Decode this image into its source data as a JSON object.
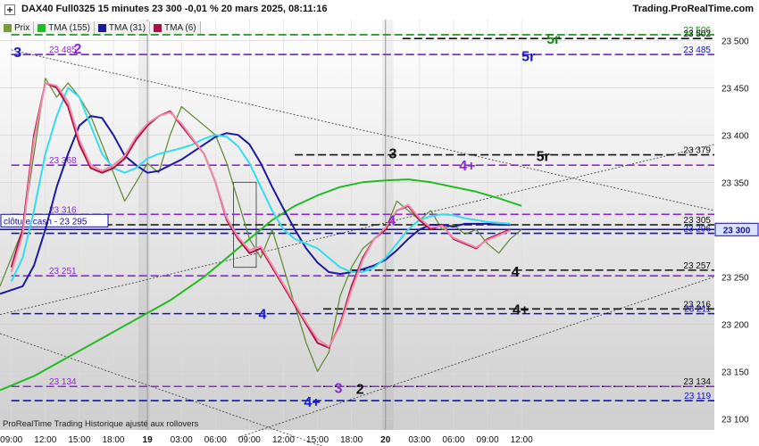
{
  "header": {
    "title": "DAX40 Full0325 15 minutes 23 300 -0,01 % 20 mars 2025, 08:11:16",
    "site": "Trading.ProRealTime.com"
  },
  "legend": [
    {
      "label": "Prix",
      "color": "#7a9a3a"
    },
    {
      "label": "TMA (155)",
      "color": "#22bb22"
    },
    {
      "label": "TMA (31)",
      "color": "#1a1aa0"
    },
    {
      "label": "TMA (6)",
      "color": "#aa1040"
    }
  ],
  "footer_note": "ProRealTime Trading  Historique ajusté aux rollovers",
  "close_label": "clôture cash -  23 295",
  "chart_data": {
    "type": "line",
    "title": "DAX40 Full0325 15 minutes",
    "ylim": [
      23088,
      23522
    ],
    "y_ticks": [
      23100,
      23150,
      23200,
      23250,
      23300,
      23350,
      23400,
      23450,
      23500
    ],
    "y_tick_labels": [
      "23 100",
      "23 150",
      "23 200",
      "23 250",
      "23 300",
      "23 350",
      "23 400",
      "23 450",
      "23 500"
    ],
    "current_price": 23300,
    "current_price_label": "23 300",
    "x_tick_labels": [
      "09:00",
      "12:00",
      "15:00",
      "18:00",
      "19",
      "03:00",
      "06:00",
      "09:00",
      "12:00",
      "15:00",
      "18:00",
      "20",
      "03:00",
      "06:00",
      "09:00",
      "12:00"
    ],
    "x_tick_bold": [
      false,
      false,
      false,
      false,
      true,
      false,
      false,
      false,
      false,
      false,
      false,
      true,
      false,
      false,
      false,
      false
    ],
    "x_range_hours": [
      -1,
      62
    ],
    "x_tick_hours": [
      0,
      3,
      6,
      9,
      12,
      15,
      18,
      21,
      24,
      27,
      30,
      33,
      36,
      39,
      42,
      45
    ],
    "levels": [
      {
        "value": 23506,
        "label": "23 506",
        "color": "#1a8a1a",
        "style": "dash",
        "side": "right",
        "x_start": 0
      },
      {
        "value": 23502,
        "label": "23 502",
        "color": "#111111",
        "style": "dash",
        "side": "right",
        "x_start": 34.5
      },
      {
        "value": 23485,
        "label": "23 485",
        "color": "#1010c8",
        "style": "dash",
        "side": "right",
        "x_start": 0
      },
      {
        "value": 23485,
        "label": "23 485",
        "color": "#8a2ad0",
        "style": "dash",
        "side": "left",
        "x_start": 0
      },
      {
        "value": 23379,
        "label": "23 379",
        "color": "#111111",
        "style": "dash",
        "side": "right",
        "x_start": 25
      },
      {
        "value": 23368,
        "label": "23 368",
        "color": "#8a2ad0",
        "style": "dash",
        "side": "left",
        "x_start": 0
      },
      {
        "value": 23316,
        "label": "23 316",
        "color": "#8a2ad0",
        "style": "dash",
        "side": "left",
        "x_start": 0
      },
      {
        "value": 23305,
        "label": "23 305",
        "color": "#111111",
        "style": "dash",
        "side": "right",
        "x_start": 0
      },
      {
        "value": 23296,
        "label": "23 296",
        "color": "#1010c8",
        "style": "dash",
        "side": "right",
        "x_start": 0
      },
      {
        "value": 23257,
        "label": "23 257",
        "color": "#111111",
        "style": "dash",
        "side": "right",
        "x_start": 30
      },
      {
        "value": 23251,
        "label": "23 251",
        "color": "#8a2ad0",
        "style": "dash",
        "side": "left",
        "x_start": 0
      },
      {
        "value": 23216,
        "label": "23 216",
        "color": "#111111",
        "style": "dash",
        "side": "right",
        "x_start": 27.5
      },
      {
        "value": 23211,
        "label": "23 211",
        "color": "#1010c8",
        "style": "dash",
        "side": "right",
        "x_start": 0
      },
      {
        "value": 23134,
        "label": "23 134",
        "color": "#111111",
        "style": "dash",
        "side": "right",
        "x_start": 27.5
      },
      {
        "value": 23134,
        "label": "23 134",
        "color": "#8a2ad0",
        "style": "dash",
        "side": "left",
        "x_start": 0
      },
      {
        "value": 23119,
        "label": "23 119",
        "color": "#1010c8",
        "style": "dash",
        "side": "right",
        "x_start": 0
      }
    ],
    "wave_labels": [
      {
        "text": "3",
        "x": 0.2,
        "y": 23488,
        "color": "#1a1ad0"
      },
      {
        "text": "2",
        "x": 5.5,
        "y": 23492,
        "color": "#8a2ad0"
      },
      {
        "text": "5r",
        "x": 45,
        "y": 23484,
        "color": "#1a1ad0"
      },
      {
        "text": "5r",
        "x": 47.2,
        "y": 23502,
        "color": "#1a8a1a"
      },
      {
        "text": "3",
        "x": 33.3,
        "y": 23381,
        "color": "#111111"
      },
      {
        "text": "4+",
        "x": 39.5,
        "y": 23368,
        "color": "#8a2ad0"
      },
      {
        "text": "5r",
        "x": 46.3,
        "y": 23378,
        "color": "#111111"
      },
      {
        "text": "4",
        "x": 33.2,
        "y": 23310,
        "color": "#8a2ad0"
      },
      {
        "text": "4",
        "x": 44.1,
        "y": 23256,
        "color": "#111111"
      },
      {
        "text": "4",
        "x": 21.8,
        "y": 23211,
        "color": "#1a1ad0"
      },
      {
        "text": "4+",
        "x": 44.2,
        "y": 23216,
        "color": "#111111"
      },
      {
        "text": "3",
        "x": 28.5,
        "y": 23133,
        "color": "#8a2ad0"
      },
      {
        "text": "2",
        "x": 30.4,
        "y": 23132,
        "color": "#111111"
      },
      {
        "text": "4+",
        "x": 25.8,
        "y": 23118,
        "color": "#1a1ad0"
      }
    ],
    "series": [
      {
        "name": "Prix",
        "color": "#5a8a2a",
        "x": [
          -1,
          0,
          1,
          2,
          3,
          4,
          5,
          6,
          7,
          8,
          9,
          10,
          11,
          12,
          13,
          14,
          15,
          16,
          17,
          18,
          19,
          20,
          21,
          22,
          23,
          24,
          25,
          26,
          27,
          28,
          29,
          30,
          31,
          32,
          33,
          34,
          35,
          36,
          37,
          38,
          39,
          40,
          41,
          42,
          43,
          44,
          45
        ],
        "y": [
          23240,
          23270,
          23300,
          23380,
          23460,
          23440,
          23455,
          23440,
          23420,
          23390,
          23360,
          23330,
          23350,
          23370,
          23360,
          23400,
          23430,
          23420,
          23410,
          23400,
          23370,
          23330,
          23290,
          23270,
          23300,
          23260,
          23220,
          23180,
          23150,
          23170,
          23230,
          23260,
          23280,
          23290,
          23300,
          23330,
          23320,
          23310,
          23320,
          23300,
          23305,
          23295,
          23300,
          23285,
          23275,
          23290,
          23300
        ]
      },
      {
        "name": "TMA (155)",
        "color": "#22bb22",
        "x": [
          -1,
          2,
          5,
          8,
          11,
          14,
          17,
          19,
          21,
          23,
          25,
          27,
          29,
          31,
          33,
          35,
          37,
          39,
          41,
          43,
          45
        ],
        "y": [
          23130,
          23145,
          23165,
          23185,
          23205,
          23225,
          23250,
          23270,
          23290,
          23310,
          23325,
          23336,
          23345,
          23350,
          23352,
          23353,
          23350,
          23345,
          23340,
          23333,
          23325
        ]
      },
      {
        "name": "TMA (31)",
        "color": "#1a1aa0",
        "x": [
          -1,
          1,
          2,
          3,
          4,
          5,
          6,
          7,
          8,
          9,
          10,
          11,
          12,
          13,
          14,
          15,
          16,
          17,
          18,
          19,
          20,
          21,
          22,
          23,
          24,
          25,
          26,
          27,
          28,
          29,
          30,
          31,
          32,
          33,
          34,
          35,
          36,
          37,
          38,
          39,
          40,
          41,
          42,
          43,
          44
        ],
        "y": [
          23232,
          23240,
          23262,
          23300,
          23345,
          23380,
          23410,
          23420,
          23418,
          23400,
          23378,
          23368,
          23360,
          23362,
          23368,
          23374,
          23382,
          23390,
          23398,
          23402,
          23400,
          23390,
          23370,
          23345,
          23322,
          23300,
          23280,
          23265,
          23255,
          23253,
          23255,
          23258,
          23262,
          23268,
          23278,
          23290,
          23300,
          23305,
          23305,
          23303,
          23306,
          23306,
          23306,
          23305,
          23305
        ]
      },
      {
        "name": "TMA (31) cyan",
        "color": "#33ddee",
        "x": [
          0,
          1,
          2,
          3,
          4,
          5,
          6,
          7,
          8,
          9,
          10,
          11,
          12,
          13,
          14,
          15,
          16,
          17,
          18,
          19,
          20,
          21,
          22,
          23,
          24,
          25,
          26,
          27,
          28,
          29,
          30,
          31,
          32,
          33,
          34,
          35,
          36,
          37,
          38,
          39,
          40,
          41,
          42,
          43,
          44
        ],
        "y": [
          23245,
          23270,
          23320,
          23380,
          23420,
          23450,
          23440,
          23410,
          23380,
          23365,
          23360,
          23365,
          23375,
          23380,
          23383,
          23386,
          23390,
          23396,
          23400,
          23398,
          23388,
          23370,
          23345,
          23320,
          23300,
          23290,
          23285,
          23280,
          23270,
          23260,
          23255,
          23255,
          23260,
          23270,
          23285,
          23300,
          23310,
          23314,
          23316,
          23315,
          23312,
          23310,
          23308,
          23307,
          23306
        ]
      },
      {
        "name": "TMA (6)",
        "color": "#aa1040",
        "x": [
          0,
          1,
          2,
          3,
          4,
          5,
          6,
          7,
          8,
          9,
          10,
          11,
          12,
          13,
          14,
          15,
          16,
          17,
          18,
          19,
          20,
          21,
          22,
          23,
          24,
          25,
          26,
          27,
          28,
          29,
          30,
          31,
          32,
          33,
          34,
          35,
          36,
          37,
          38,
          39,
          40,
          41,
          42,
          43,
          44
        ],
        "y": [
          23260,
          23300,
          23400,
          23455,
          23450,
          23430,
          23390,
          23365,
          23360,
          23365,
          23375,
          23395,
          23410,
          23420,
          23425,
          23410,
          23395,
          23380,
          23350,
          23310,
          23290,
          23275,
          23280,
          23260,
          23240,
          23220,
          23200,
          23180,
          23175,
          23200,
          23240,
          23270,
          23290,
          23300,
          23320,
          23325,
          23310,
          23300,
          23305,
          23290,
          23285,
          23280,
          23290,
          23295,
          23300
        ]
      },
      {
        "name": "TMA (6) pink",
        "color": "#f08aa8",
        "x": [
          0,
          1,
          2,
          3,
          4,
          5,
          6,
          7,
          8,
          9,
          10,
          11,
          12,
          13,
          14,
          15,
          16,
          17,
          18,
          19,
          20,
          21,
          22,
          23,
          24,
          25,
          26,
          27,
          28,
          29,
          30,
          31,
          32,
          33,
          34,
          35,
          36,
          37,
          38,
          39,
          40,
          41,
          42,
          43,
          44
        ],
        "y": [
          23255,
          23295,
          23395,
          23455,
          23452,
          23435,
          23395,
          23368,
          23362,
          23368,
          23378,
          23398,
          23412,
          23420,
          23424,
          23412,
          23396,
          23380,
          23350,
          23312,
          23292,
          23278,
          23282,
          23262,
          23242,
          23222,
          23202,
          23184,
          23176,
          23198,
          23236,
          23268,
          23290,
          23302,
          23320,
          23326,
          23312,
          23302,
          23304,
          23291,
          23286,
          23281,
          23289,
          23294,
          23299
        ]
      }
    ]
  }
}
